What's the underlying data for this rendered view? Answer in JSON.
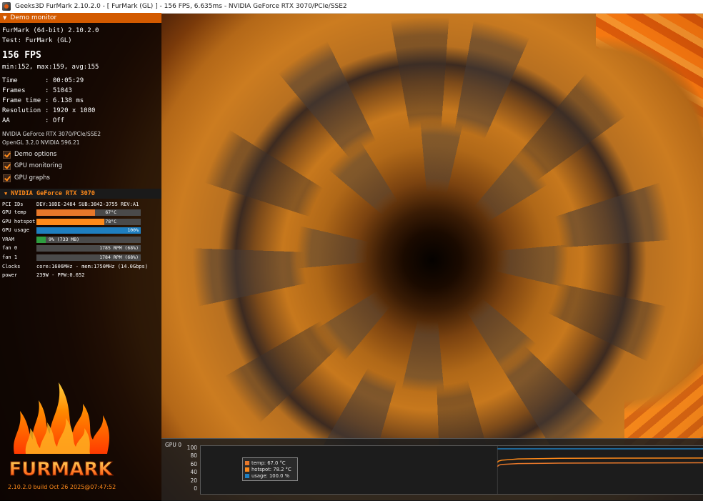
{
  "window": {
    "title": "Geeks3D FurMark 2.10.2.0 - [ FurMark (GL) ] - 156 FPS, 6.635ms - NVIDIA GeForce RTX 3070/PCIe/SSE2"
  },
  "demo_monitor": {
    "header": "Demo monitor",
    "app_line": "FurMark (64-bit) 2.10.2.0",
    "test_line": "Test: FurMark (GL)",
    "fps": "156 FPS",
    "fps_stats": "min:152, max:159, avg:155",
    "stats": [
      {
        "label": "Time",
        "value": ": 00:05:29"
      },
      {
        "label": "Frames",
        "value": ": 51043"
      },
      {
        "label": "Frame time",
        "value": ": 6.138 ms"
      },
      {
        "label": "Resolution",
        "value": ": 1920 x 1080"
      },
      {
        "label": "AA",
        "value": ": Off"
      }
    ],
    "gpu_renderer": "NVIDIA GeForce RTX 3070/PCIe/SSE2",
    "opengl_version": "OpenGL 3.2.0 NVIDIA 596.21",
    "options": [
      {
        "label": "Demo options",
        "checked": true
      },
      {
        "label": "GPU monitoring",
        "checked": true
      },
      {
        "label": "GPU graphs",
        "checked": true
      }
    ]
  },
  "gpu_monitor": {
    "header": "NVIDIA GeForce RTX 3070",
    "pci_label": "PCI IDs",
    "pci_value": "DEV:10DE-2484 SUB:3842-3755 REV:A1",
    "bars": [
      {
        "label": "GPU temp",
        "text": "67°C",
        "level": 0.56,
        "color": "#e8782a"
      },
      {
        "label": "GPU hotspot",
        "text": "78°C",
        "level": 0.65,
        "color": "#ff8a1a"
      },
      {
        "label": "GPU usage",
        "text": "100%",
        "level": 1.0,
        "color": "#1f7fc0"
      },
      {
        "label": "VRAM",
        "text": "9% (733 MB)",
        "level": 0.09,
        "color": "#2e9e40"
      },
      {
        "label": "fan 0",
        "text": "1785 RPM (68%)",
        "level": 0.0,
        "color": "#4a4a4a"
      },
      {
        "label": "fan 1",
        "text": "1784 RPM (68%)",
        "level": 0.0,
        "color": "#4a4a4a"
      }
    ],
    "clocks_label": "Clocks",
    "clocks_value": "core:1606MHz - mem:1750MHz (14.0Gbps)",
    "power_label": "power",
    "power_value": "239W - PPW:0.652"
  },
  "logo": {
    "text": "FURMARK"
  },
  "build_info": "2.10.2.0 build Oct 26 2025@07:47:52",
  "gpu_graph": {
    "title": "GPU 0",
    "yticks": [
      "100",
      "80",
      "60",
      "40",
      "20",
      "0"
    ],
    "legend": [
      {
        "label": "temp: 67.0 °C",
        "color": "#e8782a"
      },
      {
        "label": "hotspot: 78.2 °C",
        "color": "#ff8a1a"
      },
      {
        "label": "usage: 100.0 %",
        "color": "#1f7fc0"
      }
    ]
  },
  "chart_data": {
    "type": "line",
    "title": "GPU 0",
    "xlabel": "",
    "ylabel": "",
    "ylim": [
      0,
      100
    ],
    "series": [
      {
        "name": "temp: 67.0 °C",
        "x": [
          0.0,
          0.005,
          0.02,
          0.1,
          0.3,
          0.6,
          1.0
        ],
        "values": [
          58,
          61,
          63,
          65,
          66,
          66.5,
          67.0
        ]
      },
      {
        "name": "hotspot: 78.2 °C",
        "x": [
          0.0,
          0.005,
          0.02,
          0.1,
          0.3,
          0.6,
          1.0
        ],
        "values": [
          68,
          71,
          73,
          76,
          77.5,
          78,
          78.2
        ]
      },
      {
        "name": "usage: 100.0 %",
        "x": [
          0.0,
          0.005,
          0.02,
          0.1,
          0.3,
          0.6,
          1.0
        ],
        "values": [
          100,
          100,
          100,
          100,
          100,
          100,
          100
        ]
      }
    ]
  }
}
